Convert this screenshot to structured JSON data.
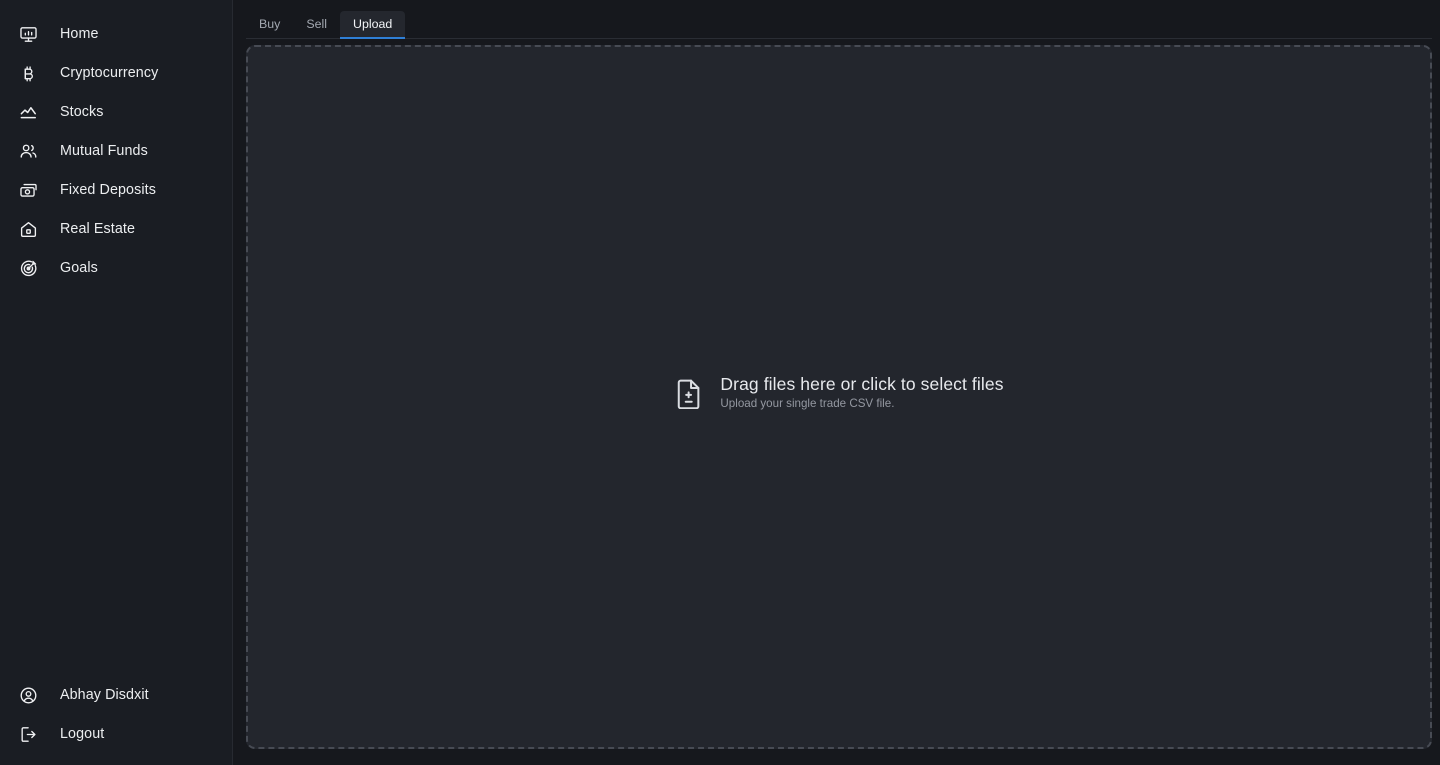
{
  "theme": {
    "page_bg": "#16181d",
    "sidebar_bg": "#1a1d23",
    "dropzone_bg": "#23262d",
    "accent": "#2f7fd6",
    "text_primary": "#e8eaed",
    "text_muted": "#9498a1",
    "dashed_border": "#474b54"
  },
  "sidebar": {
    "items": [
      {
        "label": "Home",
        "icon": "monitor-chart-icon"
      },
      {
        "label": "Cryptocurrency",
        "icon": "bitcoin-icon"
      },
      {
        "label": "Stocks",
        "icon": "line-chart-icon"
      },
      {
        "label": "Mutual Funds",
        "icon": "users-icon"
      },
      {
        "label": "Fixed Deposits",
        "icon": "banknotes-icon"
      },
      {
        "label": "Real Estate",
        "icon": "house-icon"
      },
      {
        "label": "Goals",
        "icon": "target-icon"
      }
    ],
    "footer": [
      {
        "label": "Abhay Disdxit",
        "icon": "user-circle-icon"
      },
      {
        "label": "Logout",
        "icon": "logout-icon"
      }
    ]
  },
  "main": {
    "tabs": [
      {
        "label": "Buy",
        "active": false
      },
      {
        "label": "Sell",
        "active": false
      },
      {
        "label": "Upload",
        "active": true
      }
    ],
    "dropzone": {
      "icon": "file-diff-icon",
      "title": "Drag files here or click to select files",
      "subtitle": "Upload your single trade CSV file."
    }
  }
}
